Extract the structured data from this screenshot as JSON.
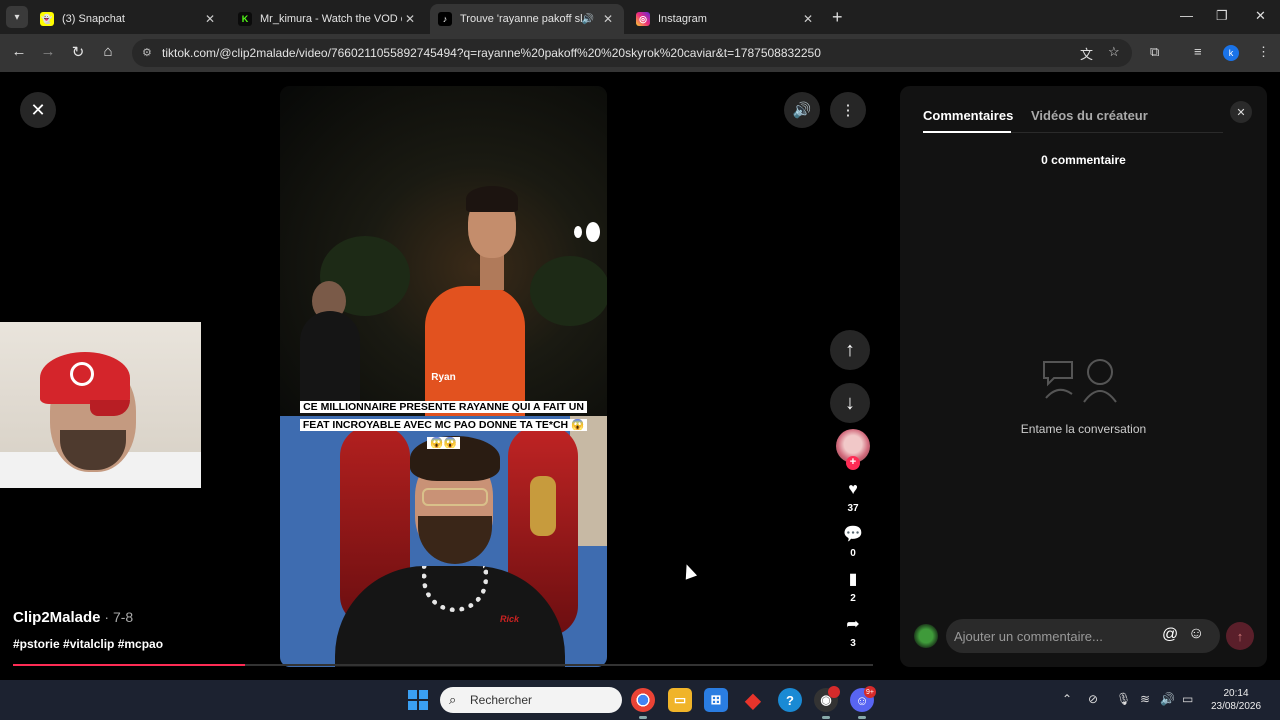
{
  "browser": {
    "tabs": [
      {
        "title": "(3) Snapchat",
        "favicon": "snapchat-icon",
        "favicon_color": "#fffc00"
      },
      {
        "title": "Mr_kimura - Watch the VOD on",
        "favicon": "kick-icon",
        "favicon_color": "#53fc18"
      },
      {
        "title": "Trouve 'rayanne pakoff skyr",
        "favicon": "tiktok-icon",
        "favicon_color": "#000000",
        "active": true,
        "audio": true
      },
      {
        "title": "Instagram",
        "favicon": "instagram-icon",
        "favicon_color": "#e1306c"
      }
    ],
    "url": "tiktok.com/@clip2malade/video/7660211055892745494?q=rayanne%20pakoff%20%20skyrok%20caviar&t=1787508832250",
    "profile_initial": "k"
  },
  "video": {
    "label_name": "Ryan",
    "caption": "CE MILLIONNAIRE PRESENTE RAYANNE QUI A FAIT UN FEAT INCROYABLE AVEC MC PAO DONNE TA TE*CH 😱😱😱",
    "shirt_logo": "Rick"
  },
  "creator": {
    "name": "Clip2Malade",
    "date": " · 7-8",
    "hashtags": "#pstorie #vitalclip #mcpao",
    "progress": 0.27
  },
  "actions": {
    "likes": "37",
    "comments": "0",
    "saves": "2",
    "shares": "3"
  },
  "panel": {
    "tab_comments": "Commentaires",
    "tab_creator_videos": "Vidéos du créateur",
    "comment_count": "0 commentaire",
    "empty_text": "Entame la conversation",
    "input_placeholder": "Ajouter un commentaire..."
  },
  "taskbar": {
    "search_placeholder": "Rechercher",
    "time": "20:14",
    "date": "23/08/2026",
    "discord_badge": "9+"
  },
  "colors": {
    "accent": "#fe2c55",
    "panel_bg": "#121212"
  }
}
